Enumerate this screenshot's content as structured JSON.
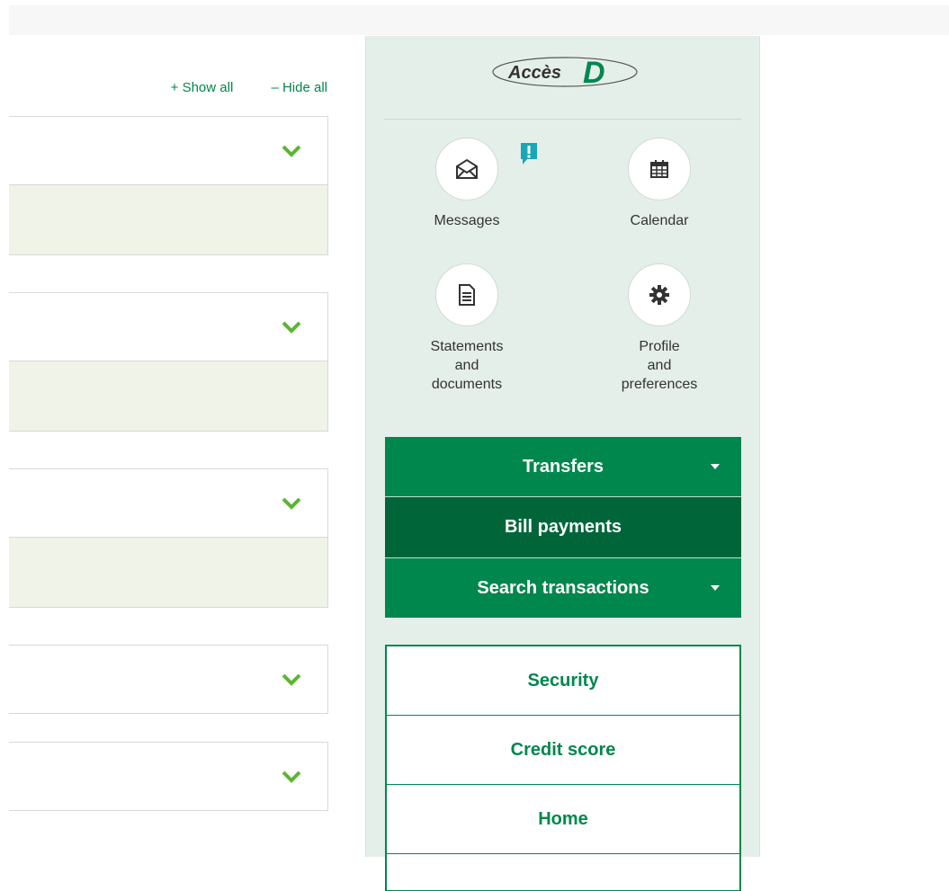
{
  "toolbar": {
    "show_all": "+ Show all",
    "hide_all": "– Hide all"
  },
  "sidebar": {
    "logo_text": "Accès",
    "logo_letter": "D",
    "tools": [
      {
        "label": "Messages",
        "icon": "envelope-icon"
      },
      {
        "label": "Calendar",
        "icon": "calendar-icon"
      },
      {
        "label": "Statements\nand\ndocuments",
        "icon": "document-icon"
      },
      {
        "label": "Profile\nand\npreferences",
        "icon": "gear-icon"
      }
    ],
    "menu": [
      {
        "label": "Transfers",
        "has_dropdown": true
      },
      {
        "label": "Bill payments",
        "active": true
      },
      {
        "label": "Search transactions",
        "has_dropdown": true
      }
    ],
    "links": [
      "Security",
      "Credit score",
      "Home"
    ]
  },
  "colors": {
    "brand_green": "#00874e",
    "dark_green": "#00663a",
    "sidebar_bg": "#e5efe9",
    "chevron": "#5cb531"
  }
}
